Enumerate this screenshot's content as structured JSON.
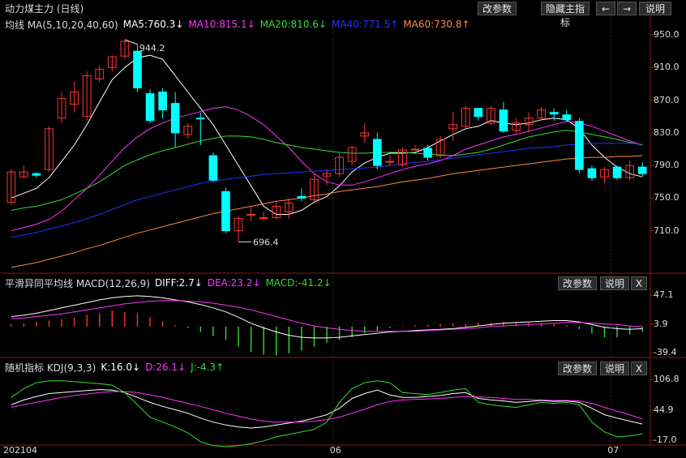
{
  "toolbar": {
    "params_label": "改参数",
    "hide_main_label": "隐藏主指标",
    "left_arrow": "←",
    "right_arrow": "→",
    "help_label": "说明"
  },
  "main_header": {
    "title": "动力煤主力 (日线)",
    "ma_label": "均线 MA(5,10,20,40,60)",
    "ma5": "MA5:760.3↓",
    "ma10": "MA10:815.1↓",
    "ma20": "MA20:810.6↓",
    "ma40": "MA40:771.5↑",
    "ma60": "MA60:730.8↑"
  },
  "macd_header": {
    "label": "平滑异同平均线 MACD(12,26,9)",
    "diff": "DIFF:2.7↓",
    "dea": "DEA:23.2↓",
    "macd": "MACD:-41.2↓",
    "params_label": "改参数",
    "help_label": "说明",
    "close_label": "X"
  },
  "kdj_header": {
    "label": "随机指标 KDJ(9,3,3)",
    "k": "K:16.0↓",
    "d": "D:26.1↓",
    "j": "J:-4.3↑",
    "params_label": "改参数",
    "help_label": "说明",
    "close_label": "X"
  },
  "colors": {
    "up": "#ff3333",
    "down": "#00ffff",
    "ma5": "#ffffff",
    "ma10": "#ff33ff",
    "ma20": "#33dd33",
    "ma40": "#2233ff",
    "ma60": "#ff8844",
    "text_gray": "#dddddd"
  },
  "chart_data": [
    {
      "type": "candlestick",
      "title": "动力煤主力 (日线)",
      "y_ticks": [
        "950.0",
        "910.0",
        "870.0",
        "830.0",
        "790.0",
        "750.0",
        "710.0"
      ],
      "ylim": [
        660,
        955
      ],
      "x_labels": [
        "202104",
        "06",
        "07"
      ],
      "annotations": [
        {
          "label": "944.2",
          "value": 944.2
        },
        {
          "label": "696.4",
          "value": 696.4
        }
      ],
      "candles": [
        [
          745,
          782,
          742,
          785
        ],
        [
          776,
          782,
          774,
          790
        ],
        [
          780,
          778,
          775,
          782
        ],
        [
          785,
          835,
          782,
          838
        ],
        [
          848,
          872,
          842,
          880
        ],
        [
          865,
          880,
          855,
          893
        ],
        [
          850,
          900,
          845,
          905
        ],
        [
          896,
          908,
          892,
          912
        ],
        [
          910,
          923,
          905,
          925
        ],
        [
          924,
          942,
          920,
          944.2
        ],
        [
          930,
          885,
          880,
          938
        ],
        [
          878,
          845,
          842,
          883
        ],
        [
          880,
          858,
          848,
          885
        ],
        [
          866,
          830,
          812,
          880
        ],
        [
          828,
          838,
          823,
          842
        ],
        [
          848,
          847,
          815,
          855
        ],
        [
          802,
          772,
          770,
          806
        ],
        [
          758,
          710,
          707,
          763
        ],
        [
          710,
          725,
          696.4,
          728
        ],
        [
          730,
          730,
          722,
          740
        ],
        [
          726,
          726,
          723,
          733
        ],
        [
          726,
          740,
          724,
          745
        ],
        [
          733,
          744,
          725,
          750
        ],
        [
          752,
          750,
          746,
          762
        ],
        [
          748,
          773,
          745,
          780
        ],
        [
          777,
          780,
          766,
          785
        ],
        [
          780,
          800,
          776,
          805
        ],
        [
          795,
          812,
          790,
          814
        ],
        [
          826,
          830,
          818,
          842
        ],
        [
          822,
          790,
          785,
          830
        ],
        [
          795,
          795,
          790,
          802
        ],
        [
          791,
          809,
          788,
          812
        ],
        [
          810,
          810,
          808,
          815
        ],
        [
          811,
          800,
          796,
          815
        ],
        [
          802,
          822,
          799,
          826
        ],
        [
          835,
          840,
          820,
          856
        ],
        [
          838,
          860,
          835,
          863
        ],
        [
          860,
          850,
          845,
          860
        ],
        [
          842,
          860,
          840,
          863
        ],
        [
          858,
          832,
          830,
          868
        ],
        [
          833,
          842,
          829,
          848
        ],
        [
          840,
          848,
          830,
          855
        ],
        [
          848,
          858,
          845,
          862
        ],
        [
          855,
          853,
          845,
          860
        ],
        [
          852,
          846,
          843,
          858
        ],
        [
          844,
          785,
          780,
          848
        ],
        [
          786,
          775,
          771,
          790
        ],
        [
          776,
          785,
          768,
          788
        ],
        [
          788,
          775,
          772,
          790
        ],
        [
          775,
          790,
          772,
          796
        ],
        [
          788,
          780,
          777,
          794
        ]
      ],
      "series": [
        {
          "name": "MA5",
          "values": [
            750,
            756,
            762,
            775,
            795,
            815,
            840,
            868,
            895,
            910,
            922,
            925,
            920,
            900,
            880,
            860,
            840,
            815,
            790,
            765,
            740,
            730,
            730,
            735,
            745,
            752,
            765,
            782,
            793,
            800,
            805,
            805,
            806,
            812,
            820,
            828,
            835,
            838,
            845,
            842,
            840,
            842,
            846,
            848,
            846,
            835,
            815,
            800,
            788,
            780,
            776
          ]
        },
        {
          "name": "MA10",
          "values": [
            710,
            714,
            718,
            724,
            734,
            748,
            762,
            778,
            795,
            812,
            825,
            835,
            842,
            848,
            852,
            856,
            860,
            862,
            858,
            850,
            840,
            826,
            812,
            795,
            780,
            770,
            766,
            766,
            770,
            775,
            780,
            785,
            789,
            792,
            796,
            802,
            810,
            815,
            820,
            825,
            828,
            832,
            836,
            840,
            844,
            842,
            838,
            832,
            826,
            820,
            815
          ]
        },
        {
          "name": "MA20",
          "values": [
            735,
            738,
            740,
            744,
            748,
            755,
            762,
            770,
            780,
            790,
            797,
            803,
            808,
            812,
            816,
            820,
            823,
            826,
            826,
            825,
            822,
            818,
            815,
            812,
            810,
            808,
            806,
            805,
            805,
            806,
            806,
            806,
            805,
            804,
            803,
            802,
            804,
            806,
            810,
            815,
            820,
            825,
            828,
            831,
            833,
            831,
            828,
            825,
            822,
            818,
            815
          ]
        },
        {
          "name": "MA40",
          "values": [
            702,
            705,
            708,
            712,
            716,
            720,
            725,
            730,
            736,
            742,
            748,
            752,
            756,
            760,
            764,
            768,
            771,
            773,
            775,
            777,
            779,
            780,
            781,
            782,
            783,
            784,
            785,
            786,
            787,
            788,
            790,
            792,
            794,
            795,
            797,
            799,
            801,
            803,
            805,
            807,
            809,
            811,
            812,
            813,
            815,
            816,
            817,
            817,
            817,
            817,
            816
          ]
        },
        {
          "name": "MA60",
          "values": [
            665,
            668,
            671,
            675,
            679,
            683,
            688,
            692,
            697,
            702,
            707,
            711,
            715,
            719,
            723,
            727,
            731,
            734,
            737,
            740,
            743,
            746,
            748,
            750,
            753,
            755,
            758,
            760,
            762,
            764,
            767,
            770,
            772,
            774,
            777,
            780,
            782,
            784,
            786,
            788,
            790,
            792,
            794,
            796,
            798,
            799,
            800,
            800,
            801,
            801,
            802
          ]
        }
      ]
    },
    {
      "type": "line",
      "title": "MACD(12,26,9)",
      "y_ticks": [
        "47.1",
        "3.9",
        "-39.4"
      ],
      "ylim": [
        -45,
        52
      ],
      "series": [
        {
          "name": "DIFF",
          "values": [
            15,
            17,
            20,
            24,
            28,
            32,
            36,
            40,
            43,
            45,
            46,
            45,
            43,
            40,
            37,
            33,
            28,
            22,
            14,
            5,
            -2,
            -8,
            -13,
            -16,
            -17,
            -17,
            -16,
            -14,
            -12,
            -10,
            -8,
            -7,
            -6,
            -5,
            -4,
            -3,
            -1,
            1,
            3,
            5,
            6,
            7,
            8,
            9,
            9,
            7,
            3,
            -1,
            -3,
            -4,
            -3
          ]
        },
        {
          "name": "DEA",
          "values": [
            12,
            13,
            15,
            17,
            19,
            22,
            25,
            28,
            31,
            34,
            36,
            38,
            39,
            39,
            38,
            37,
            35,
            32,
            29,
            25,
            20,
            15,
            10,
            5,
            1,
            -2,
            -4,
            -6,
            -7,
            -7,
            -7,
            -7,
            -7,
            -6,
            -5,
            -4,
            -3,
            -2,
            0,
            1,
            2,
            3,
            4,
            5,
            6,
            6,
            5,
            4,
            3,
            1,
            0
          ]
        },
        {
          "name": "MACD",
          "values": [
            4,
            5,
            7,
            9,
            11,
            14,
            18,
            20,
            24,
            22,
            20,
            14,
            8,
            2,
            -2,
            -8,
            -14,
            -20,
            -30,
            -38,
            -42,
            -43,
            -40,
            -36,
            -30,
            -24,
            -20,
            -16,
            -10,
            -6,
            -2,
            1,
            2,
            3,
            4,
            5,
            4,
            6,
            6,
            7,
            7,
            6,
            5,
            4,
            2,
            -4,
            -10,
            -16,
            -16,
            -12,
            -8
          ]
        }
      ]
    },
    {
      "type": "line",
      "title": "KDJ(9,3,3)",
      "y_ticks": [
        "106.8",
        "44.9",
        "-17.0"
      ],
      "ylim": [
        -25,
        115
      ],
      "series": [
        {
          "name": "K",
          "values": [
            55,
            65,
            72,
            78,
            80,
            82,
            84,
            86,
            85,
            80,
            70,
            60,
            52,
            45,
            38,
            28,
            20,
            14,
            10,
            8,
            10,
            14,
            18,
            22,
            28,
            35,
            48,
            68,
            78,
            85,
            75,
            70,
            70,
            72,
            74,
            78,
            80,
            68,
            65,
            63,
            60,
            62,
            64,
            62,
            63,
            60,
            48,
            35,
            28,
            22,
            16
          ]
        },
        {
          "name": "D",
          "values": [
            50,
            55,
            60,
            65,
            70,
            74,
            77,
            80,
            82,
            82,
            80,
            75,
            70,
            64,
            58,
            52,
            45,
            38,
            32,
            26,
            22,
            20,
            20,
            20,
            22,
            25,
            30,
            38,
            46,
            55,
            62,
            65,
            66,
            67,
            68,
            70,
            72,
            71,
            70,
            68,
            66,
            66,
            65,
            64,
            64,
            63,
            58,
            50,
            42,
            35,
            26
          ]
        },
        {
          "name": "J",
          "values": [
            70,
            88,
            100,
            104,
            104,
            102,
            100,
            98,
            95,
            80,
            55,
            30,
            20,
            10,
            -2,
            -20,
            -28,
            -30,
            -28,
            -24,
            -18,
            -10,
            -5,
            0,
            5,
            20,
            60,
            88,
            100,
            104,
            100,
            80,
            78,
            76,
            80,
            85,
            88,
            60,
            55,
            52,
            50,
            55,
            60,
            58,
            60,
            55,
            20,
            0,
            -10,
            -8,
            -4
          ]
        }
      ]
    }
  ]
}
